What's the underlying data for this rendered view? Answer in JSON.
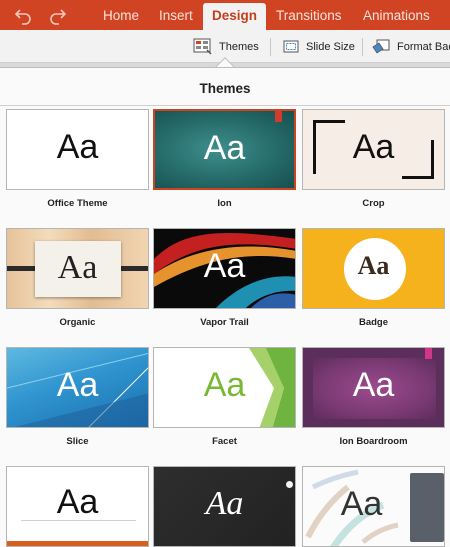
{
  "ribbon": {
    "tabs": [
      "Home",
      "Insert",
      "Design",
      "Transitions",
      "Animations"
    ],
    "active_tab": "Design"
  },
  "toolbar": {
    "themes": "Themes",
    "slide_size": "Slide Size",
    "format_background": "Format Bac"
  },
  "popover": {
    "title": "Themes",
    "preview_text": "Aa",
    "selected_theme": "Ion",
    "themes": [
      "Office Theme",
      "Ion",
      "Crop",
      "Organic",
      "Vapor Trail",
      "Badge",
      "Slice",
      "Facet",
      "Ion Boardroom"
    ]
  },
  "colors": {
    "ribbon_accent": "#d04423",
    "selection": "#c8451f"
  }
}
